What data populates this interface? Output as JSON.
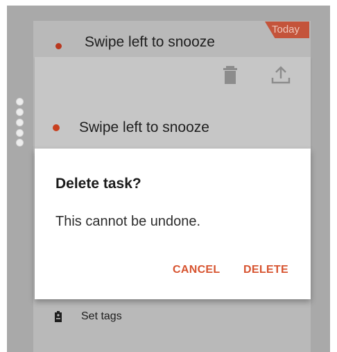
{
  "background_task": {
    "title": "Swipe left to snooze",
    "badge": "Today"
  },
  "expanded_task": {
    "title": "Swipe left to snooze",
    "actions": [
      "trash-icon",
      "upload-icon"
    ]
  },
  "dialog": {
    "title": "Delete task?",
    "message": "This cannot be undone.",
    "cancel_label": "CANCEL",
    "delete_label": "DELETE"
  },
  "task_options": {
    "set_tags_label": "Set tags"
  },
  "colors": {
    "accent": "#d7532f",
    "badge": "#c4543b",
    "dim_overlay": "#a9a9a9",
    "dialog_bg": "#ffffff"
  }
}
